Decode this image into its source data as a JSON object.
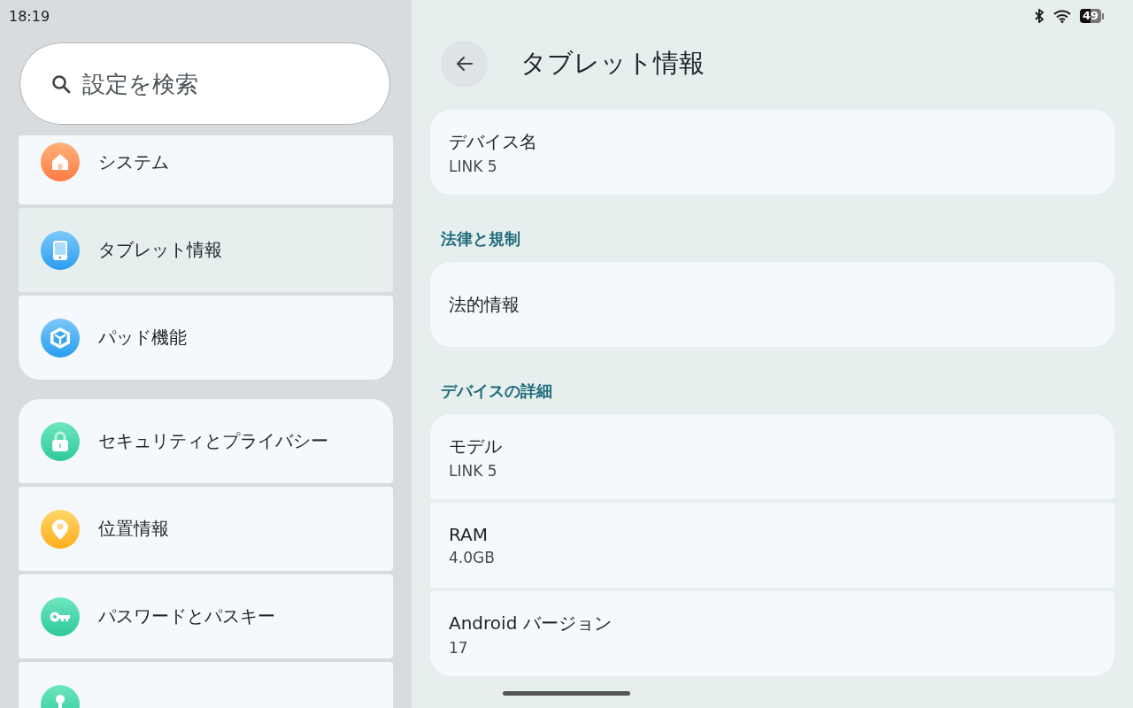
{
  "status_bar": {
    "time": "18:19",
    "battery": "49"
  },
  "search": {
    "placeholder": "設定を検索"
  },
  "sidebar": {
    "groups": [
      {
        "cut_top": true,
        "items": [
          {
            "label": "システム",
            "selected": false
          },
          {
            "label": "タブレット情報",
            "selected": true
          },
          {
            "label": "パッド機能",
            "selected": false
          }
        ]
      },
      {
        "cut_top": false,
        "items": [
          {
            "label": "セキュリティとプライバシー",
            "selected": false
          },
          {
            "label": "位置情報",
            "selected": false
          },
          {
            "label": "パスワードとパスキー",
            "selected": false
          },
          {
            "selected": false
          }
        ]
      }
    ]
  },
  "page": {
    "title": "タブレット情報",
    "sections": [
      {
        "items": [
          {
            "title": "デバイス名",
            "value": "LINK 5"
          }
        ]
      },
      {
        "heading": "法律と規制",
        "items": [
          {
            "title": "法的情報"
          }
        ]
      },
      {
        "heading": "デバイスの詳細",
        "items": [
          {
            "title": "モデル",
            "value": "LINK 5"
          },
          {
            "title": "RAM",
            "value": "4.0GB"
          },
          {
            "title": "Android バージョン",
            "value": "17"
          }
        ]
      }
    ]
  }
}
